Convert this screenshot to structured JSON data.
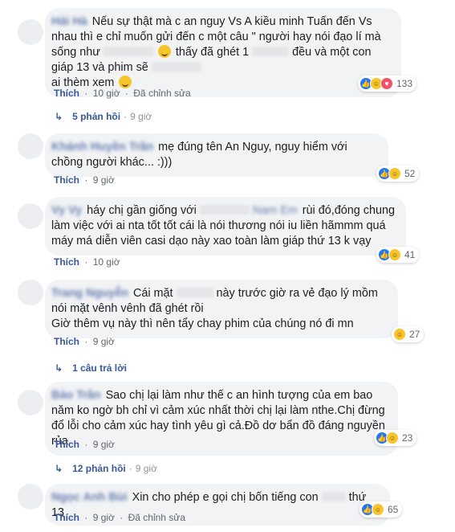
{
  "comments": [
    {
      "text_a": "Nếu sự thật mà c an nguy Vs A kiều minh Tuấn đến Vs nhau thì e chỉ muốn gửi đến c một câu \" người hay nói đạo lí mà sống như",
      "text_b": "thấy đã ghét 1",
      "text_c": "đều và một con giáp 13 và phim sẽ",
      "text_d": "ai thèm xem",
      "reaction_count": "133",
      "like_label": "Thích",
      "time": "10 giờ",
      "edited": "Đã chỉnh sửa",
      "replies_label": "5 phản hồi",
      "replies_time": "9 giờ"
    },
    {
      "text": "mẹ đúng tên An Nguy, nguy hiểm với chồng người khác... :)))",
      "reaction_count": "52",
      "like_label": "Thích",
      "time": "9 giờ"
    },
    {
      "text_a": "háy chị gần giống với",
      "text_b": "rùi đó,đóng chung làm việc với ai nta tốt tốt cái là nói thương nói iu liền hãmmm quá máy má diễn viên casi dạo này xao toàn làm giáp thứ 13 k vạy",
      "reaction_count": "41",
      "like_label": "Thích",
      "time": "10 giờ"
    },
    {
      "text_a": "Cái mặt",
      "text_b": "này trước giờ ra vẻ đạo lý mồm nói mặt vênh vênh đã ghét rồi",
      "text_c": "Giờ thêm vụ này thì nên tẩy chay phim của chúng nó đi mn",
      "reaction_count": "27",
      "like_label": "Thích",
      "time": "9 giờ",
      "replies_label": "1 câu trả lời",
      "replies_time": ""
    },
    {
      "text": "Sao chị lại làm như thế c an hình tượng của em bao năm ko ngờ bh chỉ vì cảm xúc nhất thời chị lại làm nthe.Chị đừng đổ lỗi cho cảm xúc hay tình yêu gì cả.Đồ dơ bẩn đồ đáng nguyền rủa",
      "reaction_count": "23",
      "like_label": "Thích",
      "time": "9 giờ",
      "replies_label": "12 phản hồi",
      "replies_time": "9 giờ"
    },
    {
      "text_a": "Xin cho phép e gọi chị bốn tiếng con",
      "text_b": "thứ 13",
      "reaction_count": "65",
      "like_label": "Thích",
      "time": "9 giờ",
      "edited": "Đã chỉnh sửa"
    }
  ],
  "colors": {
    "link": "#385898",
    "bubble": "#f2f3f5",
    "meta": "#606770",
    "like": "#2078f4",
    "haha": "#f7c52b",
    "love": "#f25268"
  },
  "icons": [
    "reply-arrow-icon",
    "like-reaction-icon",
    "haha-reaction-icon",
    "love-reaction-icon",
    "smile-emoji-icon"
  ]
}
